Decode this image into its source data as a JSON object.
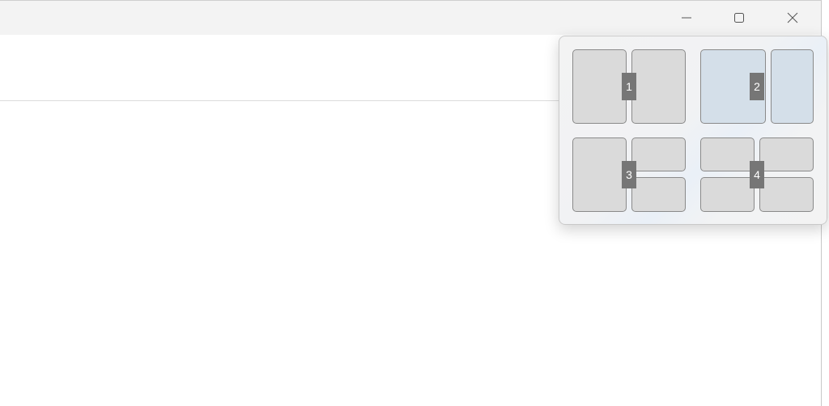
{
  "window": {
    "caption_buttons": {
      "minimize_icon": "minimize-icon",
      "maximize_icon": "maximize-icon",
      "close_icon": "close-icon"
    }
  },
  "snap_layouts": {
    "layouts": [
      {
        "number": "1"
      },
      {
        "number": "2"
      },
      {
        "number": "3"
      },
      {
        "number": "4"
      }
    ]
  },
  "colors": {
    "titlebar": "#f3f3f3",
    "zone": "#dadada",
    "zone_highlight": "#d4dfe9",
    "number_badge": "#767676"
  }
}
